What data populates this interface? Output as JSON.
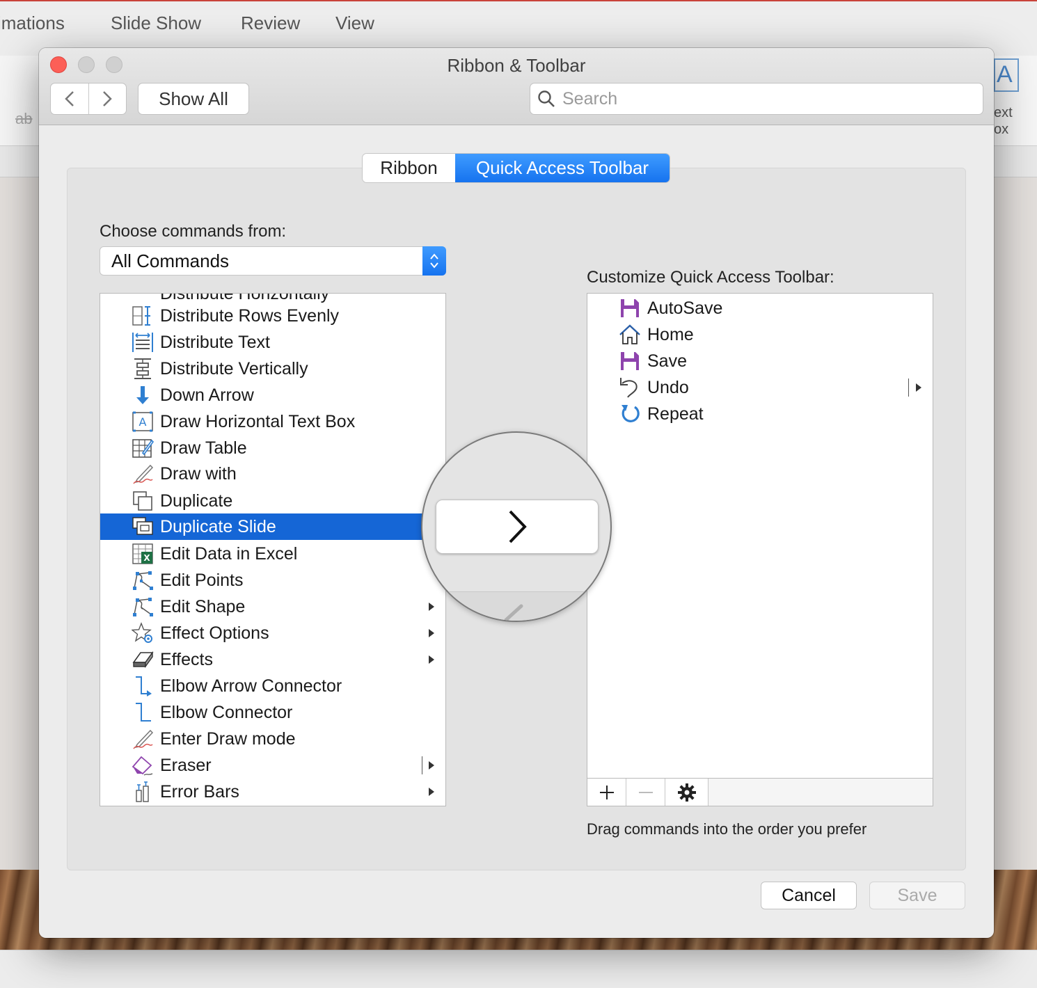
{
  "app": {
    "menu": [
      "imations",
      "Slide Show",
      "Review",
      "View"
    ],
    "bg_ab": "ab",
    "bg_textbox_label_1": "ext",
    "bg_textbox_label_2": "ox"
  },
  "window": {
    "title": "Ribbon & Toolbar"
  },
  "toolbar": {
    "show_all": "Show All",
    "search_placeholder": "Search"
  },
  "tabs": [
    {
      "label": "Ribbon",
      "selected": false
    },
    {
      "label": "Quick Access Toolbar",
      "selected": true
    }
  ],
  "commands": {
    "label": "Choose commands from:",
    "source": "All Commands",
    "partial_top_item": "Distribute Horizontally",
    "items": [
      {
        "label": "Distribute Rows Evenly",
        "icon": "distribute-rows-icon"
      },
      {
        "label": "Distribute Text",
        "icon": "distribute-text-icon"
      },
      {
        "label": "Distribute Vertically",
        "icon": "distribute-vertically-icon"
      },
      {
        "label": "Down Arrow",
        "icon": "down-arrow-icon"
      },
      {
        "label": "Draw Horizontal Text Box",
        "icon": "text-box-icon"
      },
      {
        "label": "Draw Table",
        "icon": "draw-table-icon"
      },
      {
        "label": "Draw with",
        "icon": "pen-icon"
      },
      {
        "label": "Duplicate",
        "icon": "duplicate-icon"
      },
      {
        "label": "Duplicate Slide",
        "icon": "duplicate-slide-icon",
        "selected": true
      },
      {
        "label": "Edit Data in Excel",
        "icon": "excel-icon"
      },
      {
        "label": "Edit Points",
        "icon": "edit-points-icon"
      },
      {
        "label": "Edit Shape",
        "icon": "edit-shape-icon",
        "submenu": true
      },
      {
        "label": "Effect Options",
        "icon": "effect-options-icon",
        "submenu": true
      },
      {
        "label": "Effects",
        "icon": "effects-icon",
        "submenu": true
      },
      {
        "label": "Elbow Arrow Connector",
        "icon": "elbow-arrow-icon"
      },
      {
        "label": "Elbow Connector",
        "icon": "elbow-connector-icon"
      },
      {
        "label": "Enter Draw mode",
        "icon": "draw-mode-icon"
      },
      {
        "label": "Eraser",
        "icon": "eraser-icon",
        "split": true
      },
      {
        "label": "Error Bars",
        "icon": "error-bars-icon",
        "submenu": true
      }
    ]
  },
  "qat": {
    "label": "Customize Quick Access Toolbar:",
    "items": [
      {
        "label": "AutoSave",
        "icon": "save-icon",
        "color": "#8e44ad"
      },
      {
        "label": "Home",
        "icon": "home-icon",
        "color": "#2a5fa8"
      },
      {
        "label": "Save",
        "icon": "save-icon",
        "color": "#8e44ad"
      },
      {
        "label": "Undo",
        "icon": "undo-icon",
        "split": true
      },
      {
        "label": "Repeat",
        "icon": "repeat-icon",
        "color": "#2f7fd1"
      }
    ],
    "hint": "Drag commands into the order you prefer"
  },
  "buttons": {
    "cancel": "Cancel",
    "save": "Save"
  },
  "colors": {
    "accent": "#1673ef",
    "selection": "#1566d6",
    "close": "#fc5f57"
  }
}
